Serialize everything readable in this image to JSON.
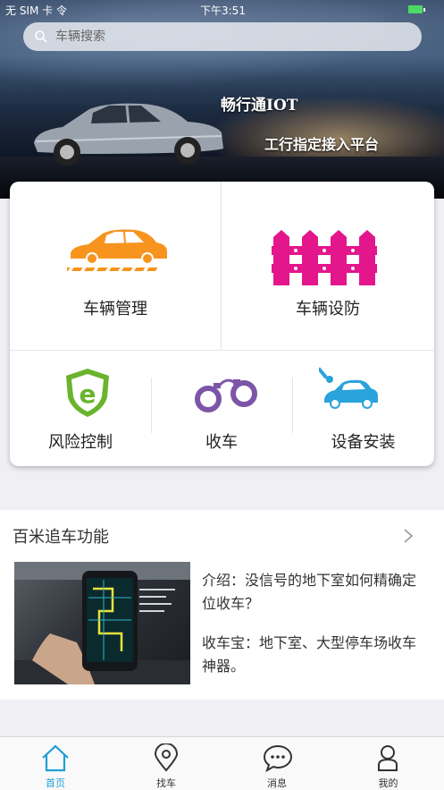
{
  "status_bar": {
    "carrier": "无 SIM 卡 令",
    "time": "下午3:51"
  },
  "search": {
    "placeholder": "车辆搜索"
  },
  "banner": {
    "brand": "畅行通IOT",
    "tagline": "工行指定接入平台"
  },
  "menu": {
    "vehicle_management": "车辆管理",
    "vehicle_defense": "车辆设防",
    "risk_control": "风险控制",
    "repossession": "收车",
    "device_install": "设备安装"
  },
  "feature": {
    "title": "百米追车功能",
    "intro": "介绍：没信号的地下室如何精确定位收车？",
    "detail": "收车宝：地下室、大型停车场收车神器。"
  },
  "tabs": [
    {
      "label": "首页",
      "icon": "home-icon",
      "active": true
    },
    {
      "label": "找车",
      "icon": "location-pin-icon",
      "active": false
    },
    {
      "label": "消息",
      "icon": "chat-bubble-icon",
      "active": false
    },
    {
      "label": "我的",
      "icon": "user-icon",
      "active": false
    }
  ],
  "colors": {
    "accent": "#1e9fd4",
    "car_orange": "#f7941d",
    "fence_magenta": "#e4168b",
    "shield_green": "#6ab42d",
    "handcuff_purple": "#7d55a8",
    "install_blue": "#2aa3dc"
  }
}
